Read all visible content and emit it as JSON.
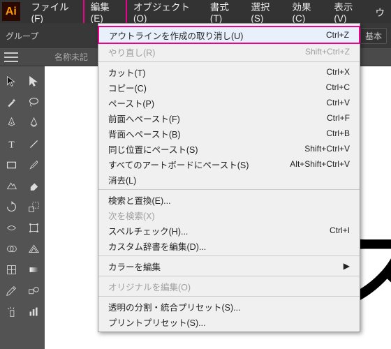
{
  "app_logo": "Ai",
  "menubar": {
    "file": "ファイル(F)",
    "edit": "編集(E)",
    "object": "オブジェクト(O)",
    "type": "書式(T)",
    "select": "選択(S)",
    "effect": "効果(C)",
    "view": "表示(V)",
    "window": "ウ"
  },
  "subbar": {
    "group_label": "グループ",
    "basic_btn": "基本"
  },
  "tab": {
    "name": "名称未記"
  },
  "canvas_text": ")ス",
  "menu": {
    "undo": {
      "label": "アウトラインを作成の取り消し(U)",
      "sc": "Ctrl+Z"
    },
    "redo": {
      "label": "やり直し(R)",
      "sc": "Shift+Ctrl+Z"
    },
    "cut": {
      "label": "カット(T)",
      "sc": "Ctrl+X"
    },
    "copy": {
      "label": "コピー(C)",
      "sc": "Ctrl+C"
    },
    "paste": {
      "label": "ペースト(P)",
      "sc": "Ctrl+V"
    },
    "paste_front": {
      "label": "前面へペースト(F)",
      "sc": "Ctrl+F"
    },
    "paste_back": {
      "label": "背面へペースト(B)",
      "sc": "Ctrl+B"
    },
    "paste_place": {
      "label": "同じ位置にペースト(S)",
      "sc": "Shift+Ctrl+V"
    },
    "paste_all": {
      "label": "すべてのアートボードにペースト(S)",
      "sc": "Alt+Shift+Ctrl+V"
    },
    "clear": {
      "label": "消去(L)",
      "sc": ""
    },
    "find": {
      "label": "検索と置換(E)...",
      "sc": ""
    },
    "find_next": {
      "label": "次を検索(X)",
      "sc": ""
    },
    "spell": {
      "label": "スペルチェック(H)...",
      "sc": "Ctrl+I"
    },
    "dict": {
      "label": "カスタム辞書を編集(D)...",
      "sc": ""
    },
    "colors": {
      "label": "カラーを編集",
      "sc": "▶"
    },
    "orig": {
      "label": "オリジナルを編集(O)",
      "sc": ""
    },
    "transp": {
      "label": "透明の分割・統合プリセット(S)...",
      "sc": ""
    },
    "print": {
      "label": "プリントプリセット(S)...",
      "sc": ""
    }
  }
}
